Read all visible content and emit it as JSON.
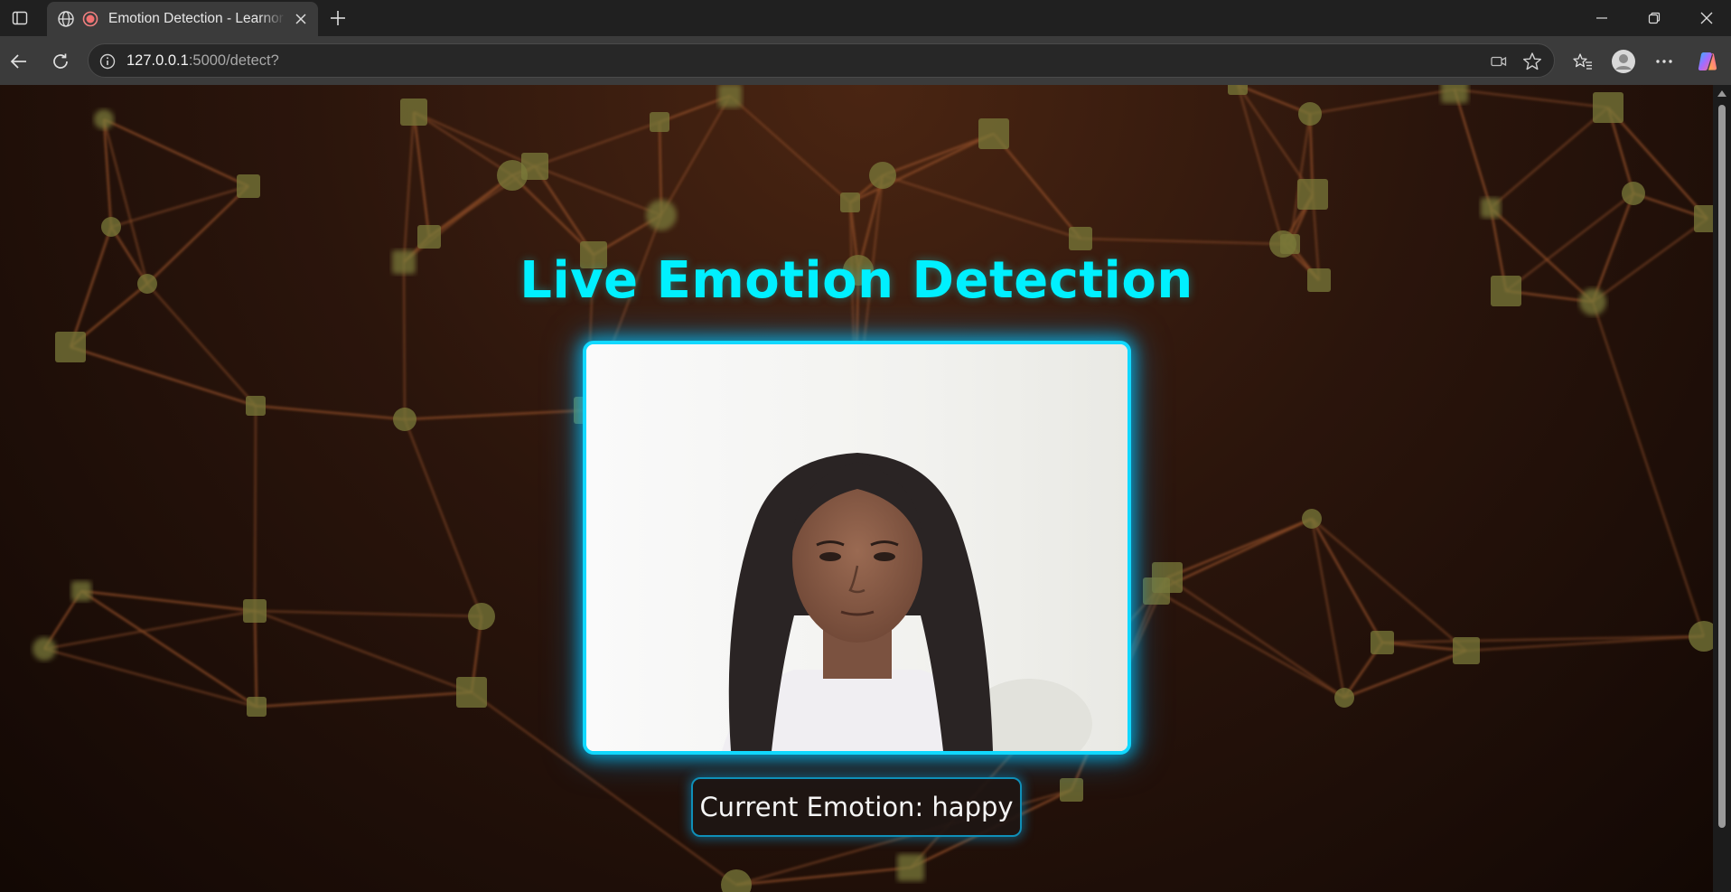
{
  "browser": {
    "tab": {
      "title": "Emotion Detection - Learnor",
      "favicon": "globe-icon",
      "recording_indicator": "recording-dot-icon"
    },
    "address_bar": {
      "host": "127.0.0.1",
      "path": ":5000/detect?"
    },
    "icons": {
      "tab_actions": "tab-actions-icon",
      "new_tab": "plus-icon",
      "back": "back-arrow-icon",
      "reload": "reload-icon",
      "site_info": "info-icon",
      "camera": "camera-icon",
      "favorite": "star-icon",
      "favorites": "favorites-icon",
      "profile": "profile-icon",
      "more": "more-icon",
      "copilot": "copilot-icon",
      "minimize": "minimize-icon",
      "restore": "restore-icon",
      "close": "close-icon"
    }
  },
  "page": {
    "heading": "Live Emotion Detection",
    "emotion_label": "Current Emotion: happy",
    "accent_color": "#00f0ff",
    "frame_color": "#11d8ff"
  }
}
